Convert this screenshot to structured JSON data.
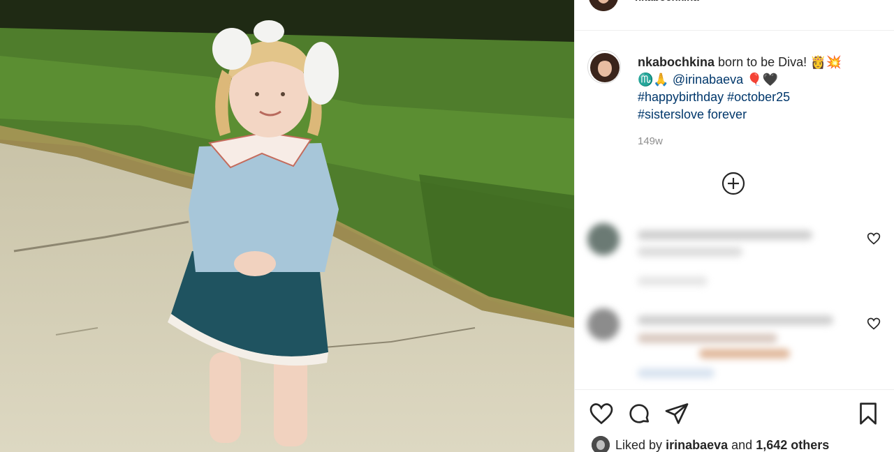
{
  "post": {
    "photo_alt": "",
    "header_username": "nkabochkina",
    "caption": {
      "username": "nkabochkina",
      "text_1": "born to be Diva!",
      "emoji_1": "👸💥",
      "emoji_2": "♏🙏",
      "mention": "@irinabaeva",
      "emoji_3": "🎈🖤",
      "hashtag_1": "#happybirthday",
      "hashtag_2": "#october25",
      "hashtag_3": "#sisterslove forever",
      "time": "149w"
    },
    "likes": {
      "prefix": "Liked by",
      "user": "irinabaeva",
      "and": "and",
      "count": "1,642 others"
    }
  },
  "icons": {
    "load_more": "plus-circle-icon",
    "like": "heart-icon",
    "comment": "comment-icon",
    "share": "paper-plane-icon",
    "save": "bookmark-icon"
  },
  "colors": {
    "link": "#00376b",
    "muted": "#8e8e8e",
    "text": "#262626"
  }
}
